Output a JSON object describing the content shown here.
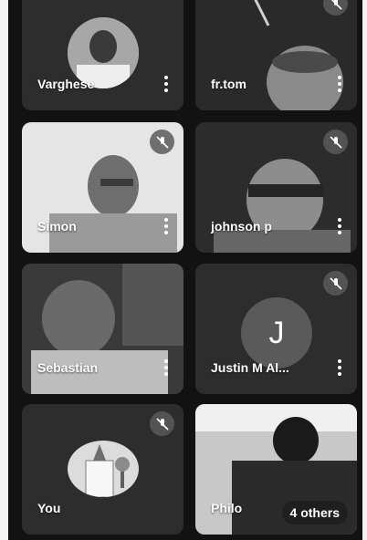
{
  "participants": [
    {
      "name": "Varghese",
      "muted": false,
      "type": "avatar"
    },
    {
      "name": "fr.tom",
      "muted": true,
      "type": "video"
    },
    {
      "name": "Simon",
      "muted": true,
      "type": "video"
    },
    {
      "name": "johnson p",
      "muted": true,
      "type": "video"
    },
    {
      "name": "Sebastian",
      "muted": false,
      "type": "video"
    },
    {
      "name": "Justin M Al...",
      "initial": "J",
      "muted": true,
      "type": "initial"
    },
    {
      "name": "You",
      "muted": true,
      "type": "avatar"
    },
    {
      "name": "Philo",
      "muted": false,
      "type": "video"
    }
  ],
  "overflow": {
    "label": "4 others"
  },
  "icons": {
    "menu": "more-vertical-icon",
    "mute": "mic-off-icon"
  },
  "colors": {
    "background": "#121212",
    "tile": "#2d2d2d",
    "initial_avatar": "#5a5a5a"
  }
}
